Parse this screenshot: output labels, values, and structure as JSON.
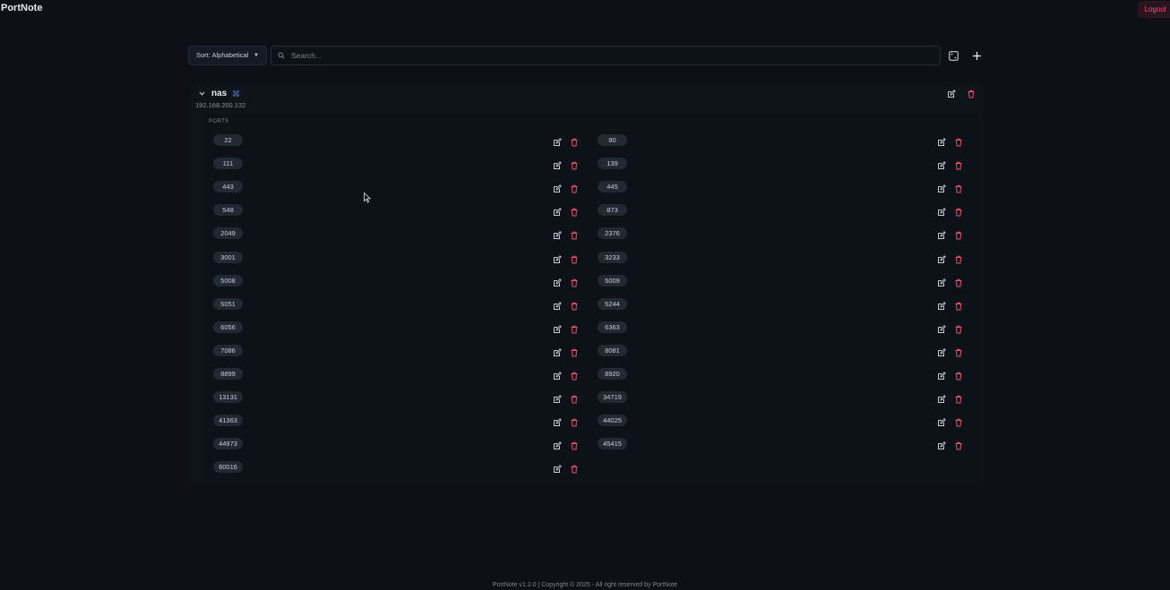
{
  "app": {
    "title": "PortNote"
  },
  "header": {
    "logout_label": "Logout"
  },
  "toolbar": {
    "sort_label": "Sort: Alphabetical",
    "search_placeholder": "Search...",
    "search_value": ""
  },
  "server": {
    "name": "nas",
    "ip": "192.168.200.132",
    "ports_label": "PORTS",
    "ports_left": [
      "22",
      "111",
      "443",
      "548",
      "2049",
      "3001",
      "5008",
      "5051",
      "6056",
      "7086",
      "8899",
      "13131",
      "41363",
      "44973",
      "60016"
    ],
    "ports_right": [
      "80",
      "139",
      "445",
      "873",
      "2376",
      "3233",
      "5009",
      "5244",
      "6363",
      "8081",
      "8920",
      "34719",
      "44025",
      "45415"
    ]
  },
  "icons": {
    "search": "search-icon",
    "ports": "dice-icon",
    "add": "plus-icon",
    "collapse": "chevron-down-icon",
    "tag": "network-icon",
    "edit": "edit-icon",
    "delete": "trash-icon"
  },
  "colors": {
    "background": "#0d1117",
    "danger": "#f0506e",
    "accent": "#3b82f6"
  },
  "footer": {
    "text": "PortNote v1.2.0 | Copyright © 2025 - All right reserved by PortNote"
  }
}
